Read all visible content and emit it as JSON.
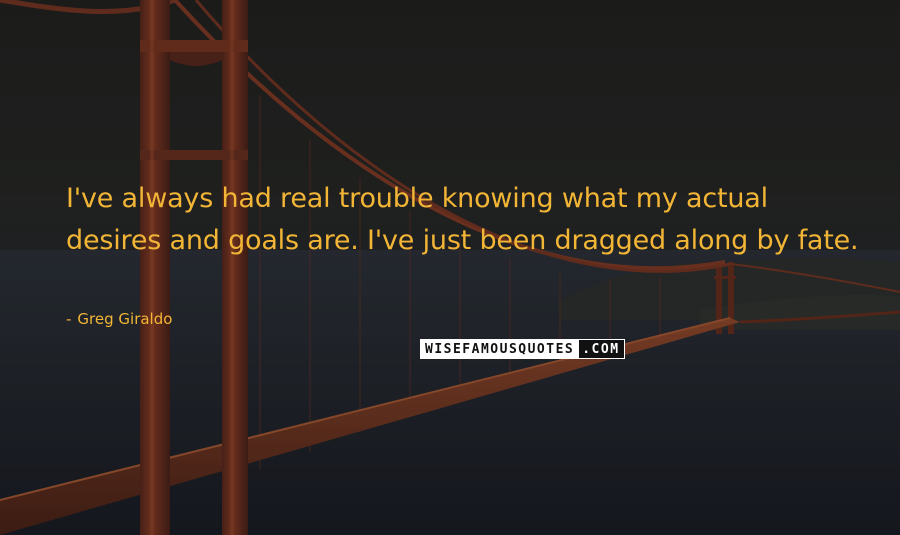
{
  "quote": {
    "text": "I've always had real trouble knowing what my actual desires and goals are. I've just been dragged along by fate."
  },
  "author": {
    "dash": "-",
    "name": "Greg Giraldo"
  },
  "watermark": {
    "part1": "WISEFAMOUSQUOTES",
    "part2": ".COM"
  },
  "colors": {
    "text": "#f2b536",
    "bridge": "#8a3a22"
  }
}
